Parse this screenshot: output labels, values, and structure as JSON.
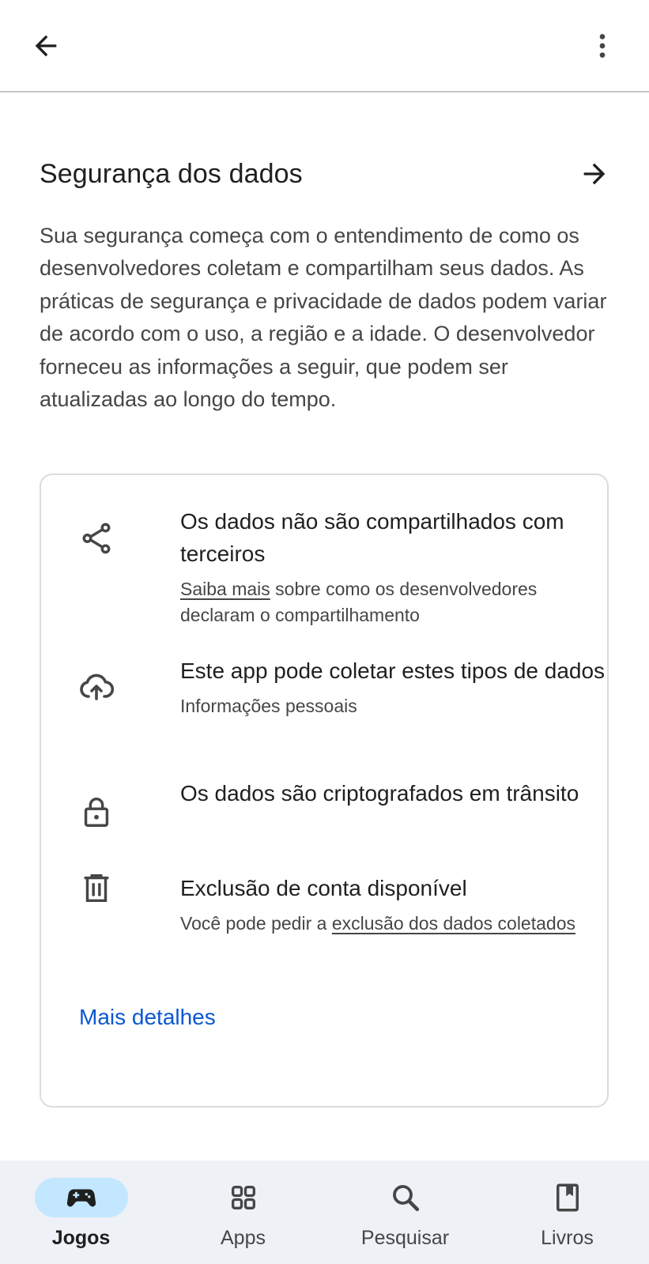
{
  "header": {
    "back_icon": "arrow-back-icon",
    "more_icon": "more-vert-icon"
  },
  "section": {
    "title": "Segurança dos dados",
    "arrow_icon": "arrow-forward-icon",
    "description": "Sua segurança começa com o entendimento de como os desenvolvedores coletam e compartilham seus dados. As práticas de segurança e privacidade de dados podem variar de acordo com o uso, a região e a idade. O desenvolvedor forneceu as informações a seguir, que podem ser atualizadas ao longo do tempo."
  },
  "card": {
    "items": [
      {
        "icon": "share-icon",
        "title": "Os dados não são compartilhados com terceiros",
        "sub_link": "Saiba mais",
        "sub_rest": " sobre como os desenvolvedores declaram o compartilhamento"
      },
      {
        "icon": "cloud-upload-icon",
        "title": "Este app pode coletar estes tipos de dados",
        "sub": "Informações pessoais"
      },
      {
        "icon": "lock-icon",
        "title": "Os dados são criptografados em trânsito"
      },
      {
        "icon": "trash-icon",
        "title": "Exclusão de conta disponível",
        "sub_prefix": "Você pode pedir a ",
        "sub_link": "exclusão dos dados coletados"
      }
    ],
    "more_details": "Mais detalhes"
  },
  "bottom_nav": {
    "items": [
      {
        "label": "Jogos",
        "icon": "gamepad-icon",
        "active": true
      },
      {
        "label": "Apps",
        "icon": "apps-grid-icon",
        "active": false
      },
      {
        "label": "Pesquisar",
        "icon": "search-icon",
        "active": false
      },
      {
        "label": "Livros",
        "icon": "bookmark-book-icon",
        "active": false
      }
    ],
    "active_pill_color": "#c2e7ff"
  }
}
